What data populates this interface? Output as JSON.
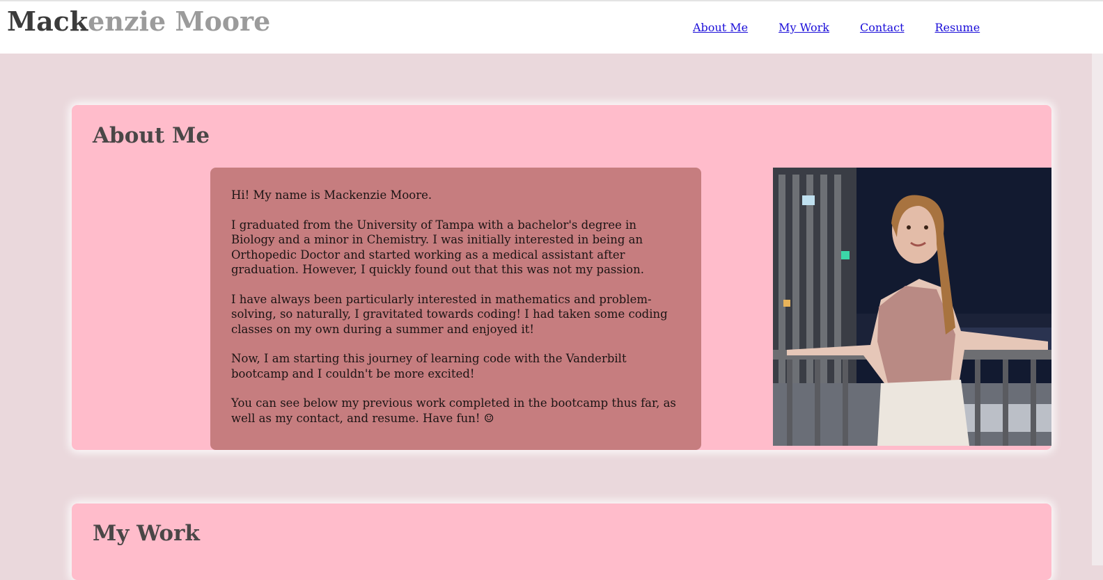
{
  "header": {
    "brand_dark": "Mack",
    "brand_light": "enzie Moore",
    "nav": [
      {
        "label": "About Me"
      },
      {
        "label": "My Work"
      },
      {
        "label": "Contact"
      },
      {
        "label": "Resume"
      }
    ]
  },
  "about": {
    "title": "About Me",
    "paragraphs": [
      "Hi! My name is Mackenzie Moore.",
      "I graduated from the University of Tampa with a bachelor's degree in Biology and a minor in Chemistry. I was initially interested in being an Orthopedic Doctor and started working as a medical assistant after graduation. However, I quickly found out that this was not my passion.",
      "I have always been particularly interested in mathematics and problem-solving, so naturally, I gravitated towards coding! I had taken some coding classes on my own during a summer and enjoyed it!",
      "Now, I am starting this journey of learning code with the Vanderbilt bootcamp and I couldn't be more excited!",
      "You can see below my previous work completed in the bootcamp thus far, as well as my contact, and resume. Have fun! ☺"
    ]
  },
  "work": {
    "title": "My Work"
  },
  "colors": {
    "page_bg": "#ead8dc",
    "card_bg": "#ffbccb",
    "bio_bg": "#c67d7f",
    "link": "#1a0dd9"
  }
}
